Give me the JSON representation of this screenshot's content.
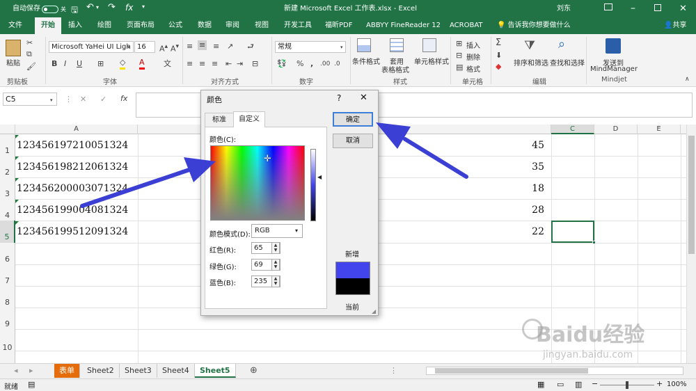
{
  "titlebar": {
    "autosave_label": "自动保存",
    "autosave_state": "关",
    "window_title": "新建 Microsoft Excel 工作表.xlsx - Excel",
    "user": "刘东"
  },
  "ribbon_tabs": [
    {
      "label": "文件"
    },
    {
      "label": "开始"
    },
    {
      "label": "插入"
    },
    {
      "label": "绘图"
    },
    {
      "label": "页面布局"
    },
    {
      "label": "公式"
    },
    {
      "label": "数据"
    },
    {
      "label": "审阅"
    },
    {
      "label": "视图"
    },
    {
      "label": "开发工具"
    },
    {
      "label": "福昕PDF"
    },
    {
      "label": "ABBYY FineReader 12"
    },
    {
      "label": "ACROBAT"
    }
  ],
  "active_tab": "开始",
  "tell_me": "告诉我你想要做什么",
  "share": "共享",
  "ribbon": {
    "paste": "粘贴",
    "clipboard": "剪贴板",
    "font_name": "Microsoft YaHei UI Ligh",
    "font_size": "16",
    "font_group": "字体",
    "align_group": "对齐方式",
    "number_format": "常规",
    "number_group": "数字",
    "cond_format": "条件格式",
    "table_format_1": "套用",
    "table_format_2": "表格格式",
    "cell_style": "单元格样式",
    "styles_group": "样式",
    "insert": "插入",
    "delete": "删除",
    "format": "格式",
    "cells_group": "单元格",
    "sort_filter": "排序和筛选",
    "find_select": "查找和选择",
    "edit_group": "编辑",
    "send_1": "发送到",
    "send_2": "MindManager",
    "mindjet_group": "Mindjet"
  },
  "formula_bar": {
    "name_box": "C5",
    "fx": "fx",
    "value": ""
  },
  "columns": [
    "A",
    "C",
    "D",
    "E"
  ],
  "rows": [
    {
      "num": "1",
      "a": "123456197210051324",
      "b": "45"
    },
    {
      "num": "2",
      "a": "123456198212061324",
      "b": "35"
    },
    {
      "num": "3",
      "a": "123456200003071324",
      "b": "18"
    },
    {
      "num": "4",
      "a": "123456199004081324",
      "b": "28"
    },
    {
      "num": "5",
      "a": "123456199512091324",
      "b": "22"
    },
    {
      "num": "6",
      "a": "",
      "b": ""
    },
    {
      "num": "7",
      "a": "",
      "b": ""
    },
    {
      "num": "8",
      "a": "",
      "b": ""
    },
    {
      "num": "9",
      "a": "",
      "b": ""
    },
    {
      "num": "10",
      "a": "",
      "b": ""
    }
  ],
  "sheets": [
    {
      "label": "表单",
      "highlight": "#e46c0a"
    },
    {
      "label": "Sheet2"
    },
    {
      "label": "Sheet3"
    },
    {
      "label": "Sheet4"
    },
    {
      "label": "Sheet5",
      "active": true
    }
  ],
  "status": {
    "ready": "就绪",
    "zoom": "100%"
  },
  "dialog": {
    "title": "颜色",
    "help": "?",
    "tab_standard": "标准",
    "tab_custom": "自定义",
    "colors_label": "颜色(C):",
    "model_label": "颜色模式(D):",
    "model_value": "RGB",
    "red_label": "红色(R):",
    "green_label": "绿色(G):",
    "blue_label": "蓝色(B):",
    "red": "65",
    "green": "69",
    "blue": "235",
    "ok": "确定",
    "cancel": "取消",
    "new_label": "新增",
    "current_label": "当前",
    "new_color": "#4145eb",
    "current_color": "#000000"
  },
  "watermark": {
    "text": "Baidu经验",
    "url": "jingyan.baidu.com"
  },
  "colors": {
    "excel_green": "#217346",
    "arrow": "#3b3fd4"
  }
}
